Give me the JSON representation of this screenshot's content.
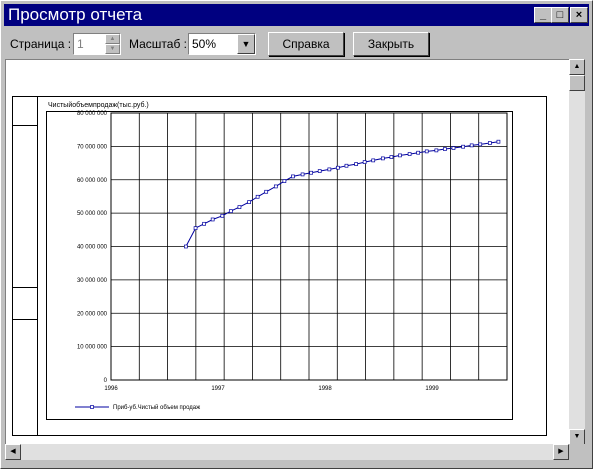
{
  "window": {
    "title": "Просмотр отчета",
    "controls": {
      "minimize": "_",
      "maximize": "□",
      "close": "×"
    }
  },
  "toolbar": {
    "page_label": "Страница :",
    "page_value": "1",
    "zoom_label": "Масштаб :",
    "zoom_value": "50%",
    "help_label": "Справка",
    "close_label": "Закрыть"
  },
  "report": {
    "chart_title": "Чистыйобъемпродаж(тыс.руб.)"
  },
  "chart_data": {
    "type": "line",
    "title": "Чистыйобъемпродаж(тыс.руб.)",
    "ylim": [
      0,
      80000000
    ],
    "yticks": [
      "0",
      "10 000 000",
      "20 000 000",
      "30 000 000",
      "40 000 000",
      "50 000 000",
      "60 000 000",
      "70 000 000",
      "80 000 000"
    ],
    "xlim": [
      1996,
      1999.7
    ],
    "xticks": [
      "1996",
      "1997",
      "1998",
      "1999"
    ],
    "xtick_values": [
      1996,
      1997,
      1998,
      1999
    ],
    "legend_position": "bottom",
    "color": "#0000a0",
    "series": [
      {
        "name": "Приб-уб.Чистый объем продаж",
        "x": [
          1996.7,
          1996.79,
          1996.87,
          1996.95,
          1997.04,
          1997.12,
          1997.2,
          1997.29,
          1997.37,
          1997.45,
          1997.54,
          1997.62,
          1997.7,
          1997.79,
          1997.87,
          1997.95,
          1998.04,
          1998.12,
          1998.2,
          1998.29,
          1998.37,
          1998.45,
          1998.54,
          1998.62,
          1998.7,
          1998.79,
          1998.87,
          1998.95,
          1999.04,
          1999.12,
          1999.2,
          1999.29,
          1999.37,
          1999.45,
          1999.54,
          1999.62
        ],
        "values": [
          40000000,
          45500000,
          46800000,
          48100000,
          49200000,
          50600000,
          51800000,
          53300000,
          54900000,
          56400000,
          58000000,
          59600000,
          61000000,
          61600000,
          62100000,
          62600000,
          63100000,
          63600000,
          64200000,
          64700000,
          65300000,
          65800000,
          66400000,
          66800000,
          67300000,
          67700000,
          68100000,
          68500000,
          68800000,
          69200000,
          69500000,
          69900000,
          70300000,
          70600000,
          71000000,
          71400000
        ]
      }
    ]
  }
}
